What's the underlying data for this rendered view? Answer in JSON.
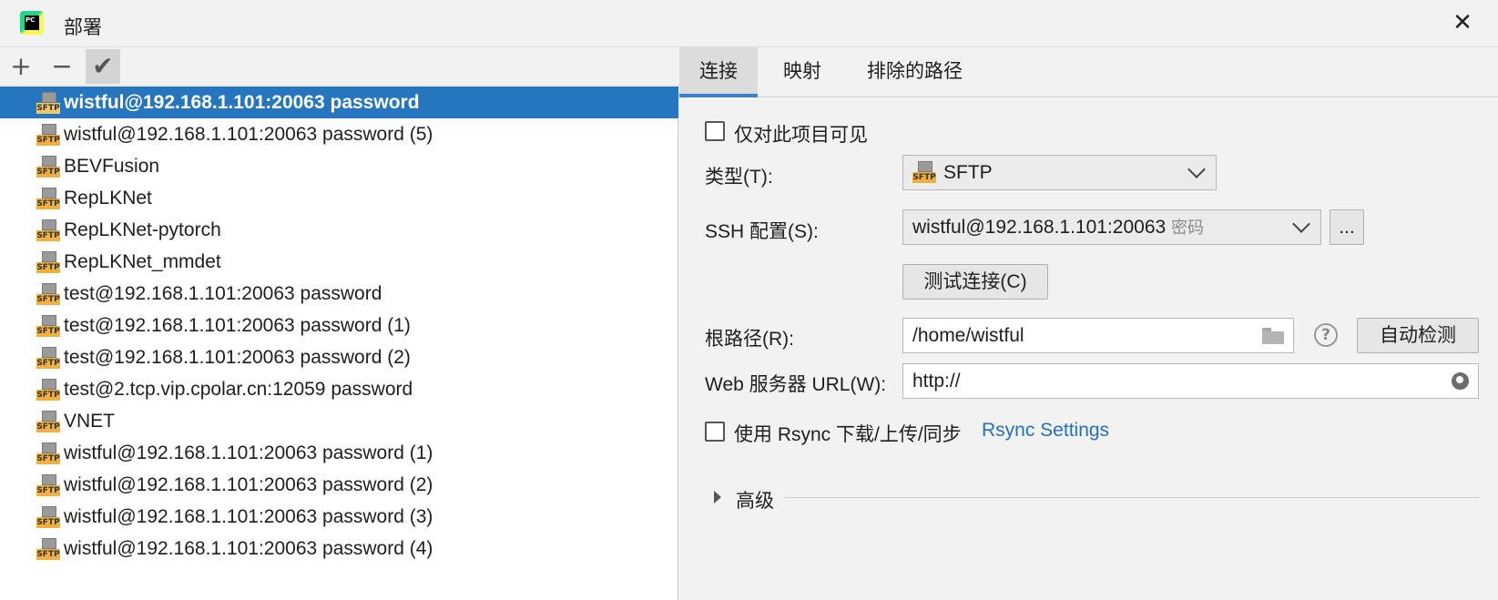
{
  "window": {
    "title": "部署",
    "close_symbol": "✕",
    "app_icon_text": "PC"
  },
  "toolbar": {
    "add_symbol": "+",
    "remove_symbol": "−",
    "apply_symbol": "✔"
  },
  "servers": [
    {
      "label": "wistful@192.168.1.101:20063 password",
      "selected": true
    },
    {
      "label": "wistful@192.168.1.101:20063 password (5)"
    },
    {
      "label": "BEVFusion"
    },
    {
      "label": "RepLKNet"
    },
    {
      "label": "RepLKNet-pytorch"
    },
    {
      "label": "RepLKNet_mmdet"
    },
    {
      "label": "test@192.168.1.101:20063 password"
    },
    {
      "label": "test@192.168.1.101:20063 password (1)"
    },
    {
      "label": "test@192.168.1.101:20063 password (2)"
    },
    {
      "label": "test@2.tcp.vip.cpolar.cn:12059 password"
    },
    {
      "label": "VNET"
    },
    {
      "label": "wistful@192.168.1.101:20063 password (1)"
    },
    {
      "label": "wistful@192.168.1.101:20063 password (2)"
    },
    {
      "label": "wistful@192.168.1.101:20063 password (3)"
    },
    {
      "label": "wistful@192.168.1.101:20063 password (4)"
    }
  ],
  "server_icon_text": "SFTP",
  "tabs": [
    {
      "label": "连接",
      "active": true
    },
    {
      "label": "映射"
    },
    {
      "label": "排除的路径"
    }
  ],
  "form": {
    "visible_only_label": "仅对此项目可见",
    "visible_only_checked": false,
    "type_label": "类型(T):",
    "type_value": "SFTP",
    "ssh_label": "SSH 配置(S):",
    "ssh_value": "wistful@192.168.1.101:20063",
    "ssh_value_suffix": "密码",
    "ssh_more_button": "...",
    "test_connection_button": "测试连接(C)",
    "root_path_label": "根路径(R):",
    "root_path_value": "/home/wistful",
    "help_symbol": "?",
    "autodetect_button": "自动检测",
    "web_url_label": "Web 服务器 URL(W):",
    "web_url_value": "http://",
    "rsync_label": "使用 Rsync 下载/上传/同步",
    "rsync_checked": false,
    "rsync_settings_link": "Rsync Settings",
    "advanced_label": "高级"
  }
}
